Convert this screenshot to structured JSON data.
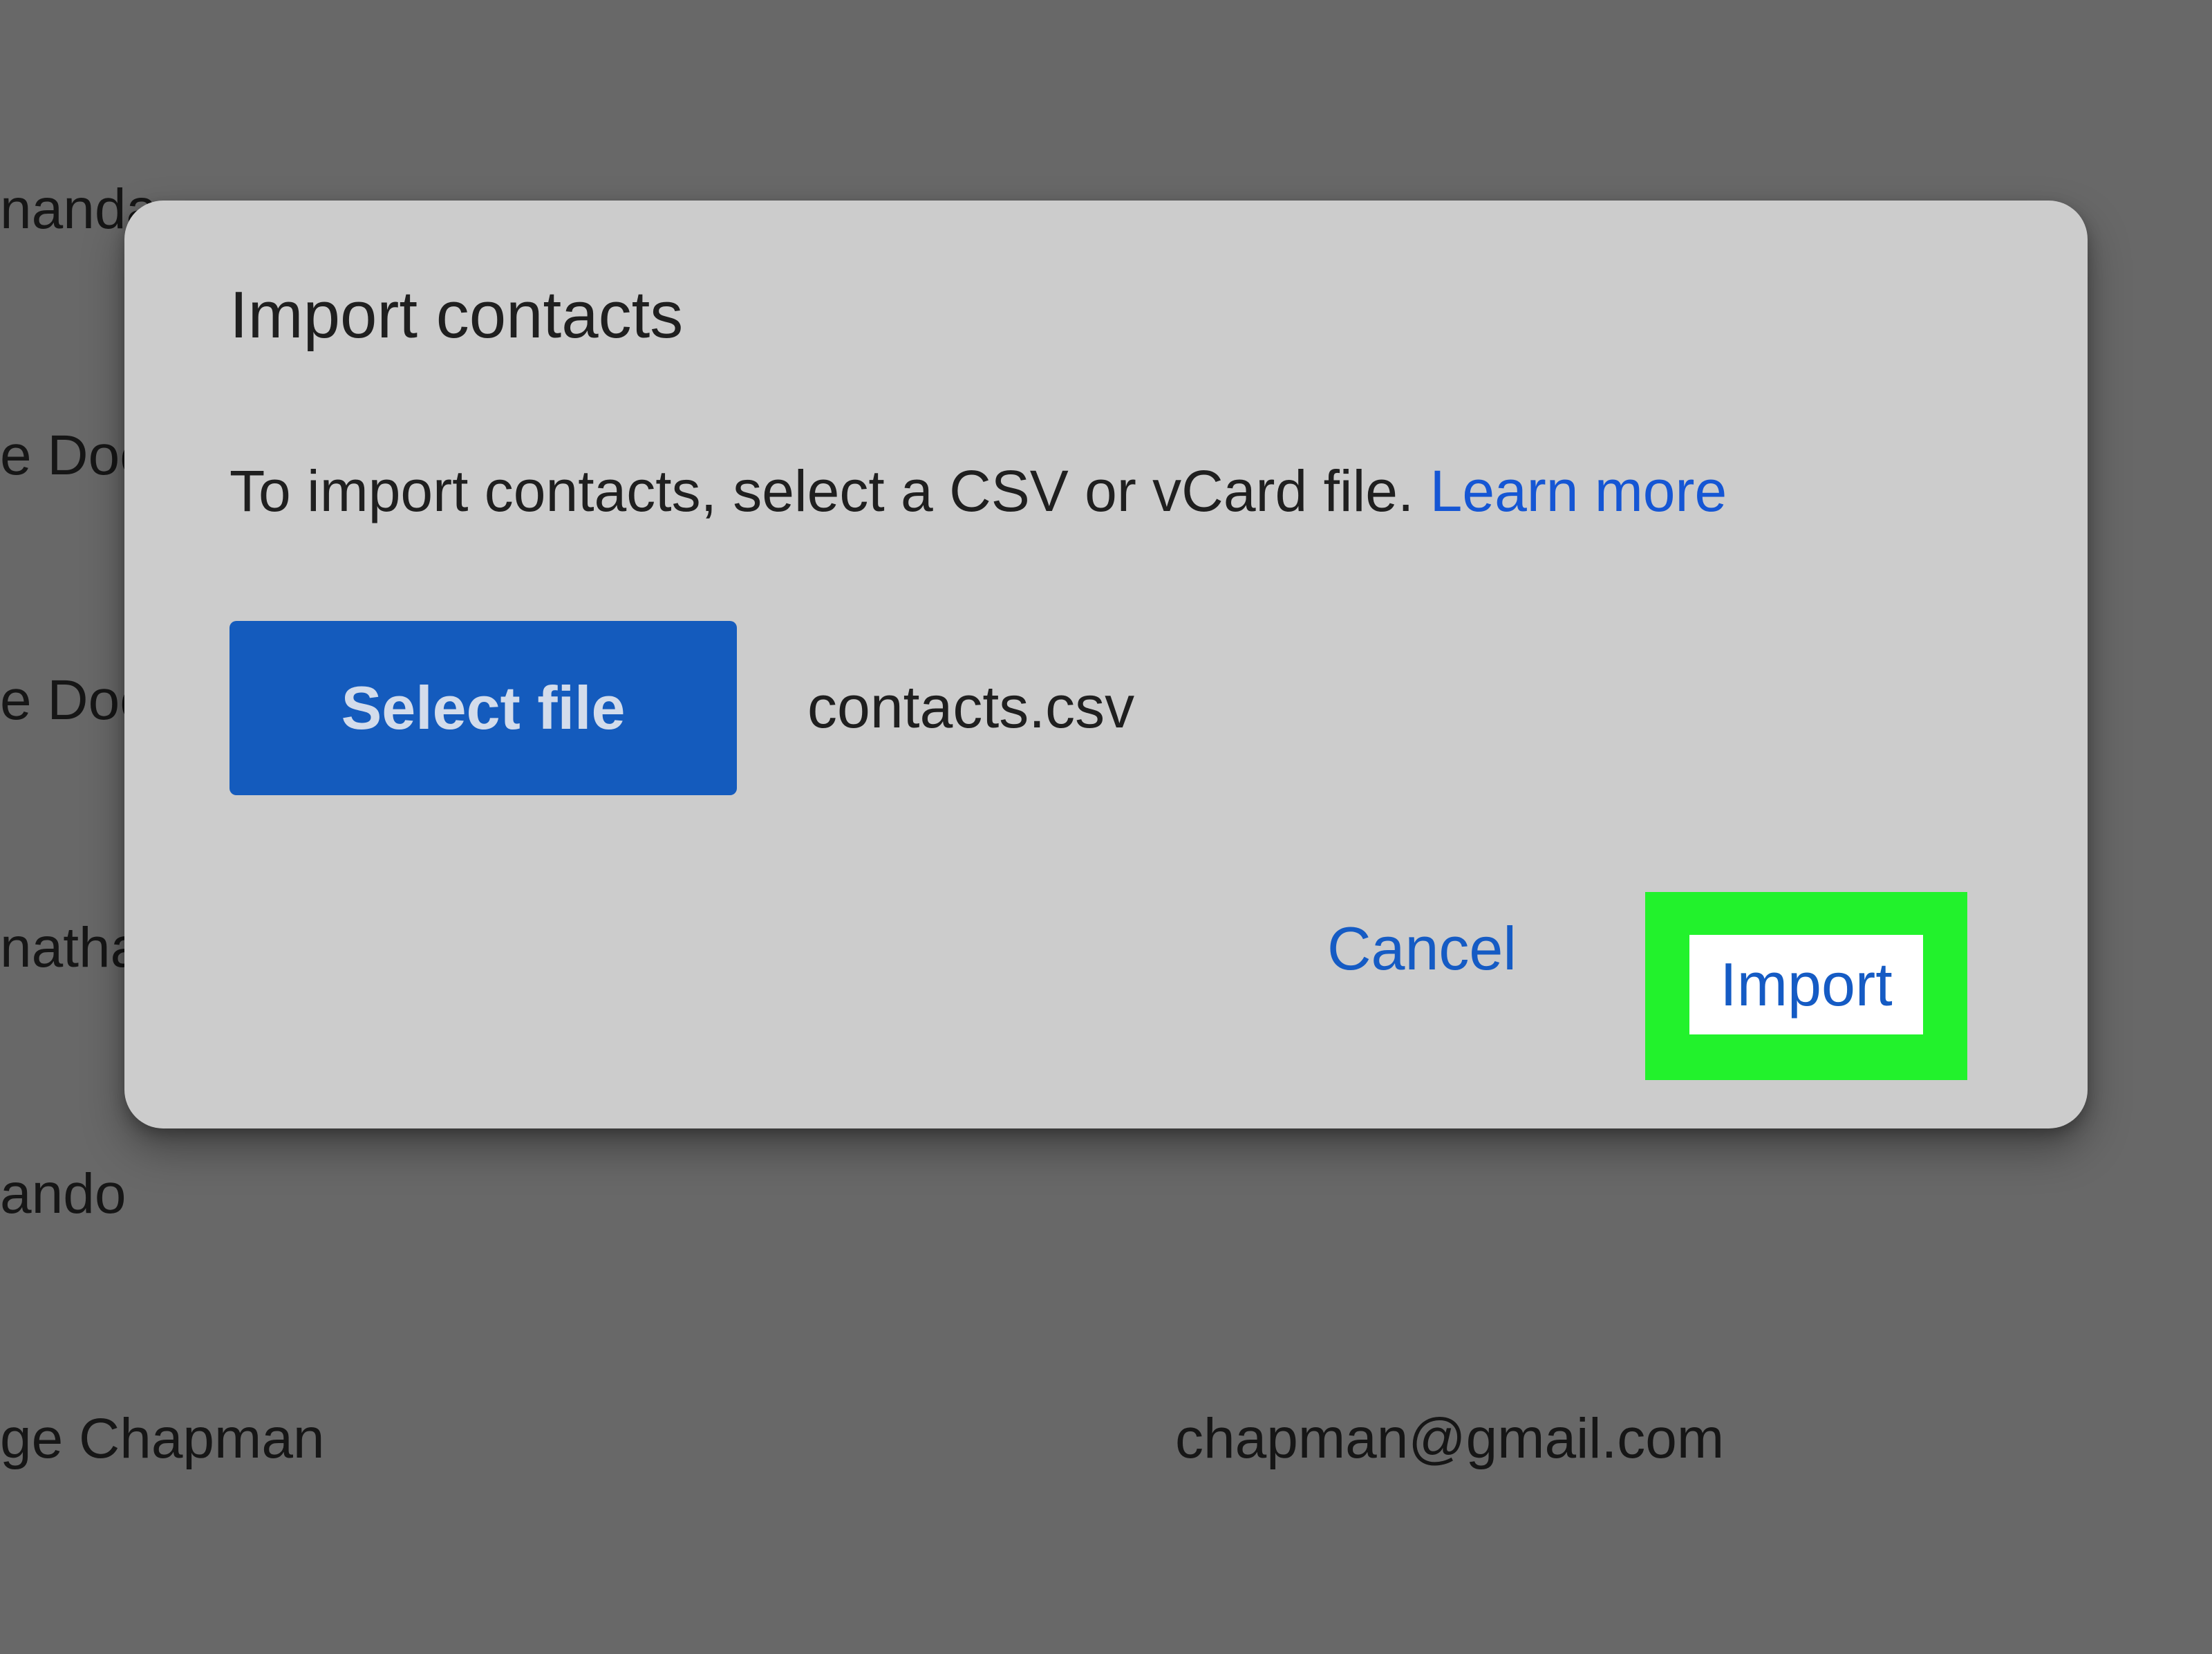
{
  "background_list": {
    "rows": [
      {
        "name": "nanda"
      },
      {
        "name": "e Doe"
      },
      {
        "name": "e Doe"
      },
      {
        "name": "natha"
      },
      {
        "name": "ando"
      },
      {
        "name": "ge Chapman",
        "email": "chapman@gmail.com"
      }
    ]
  },
  "dialog": {
    "title": "Import contacts",
    "description": "To import contacts, select a CSV or vCard file.",
    "learn_more_label": "Learn more",
    "select_file_label": "Select file",
    "selected_file_name": "contacts.csv",
    "cancel_label": "Cancel",
    "import_label": "Import"
  },
  "colors": {
    "overlay": "#686868",
    "dialog_bg": "#cccccc",
    "primary_button": "#145bbd",
    "link": "#1556d4",
    "highlight": "#22f22c"
  }
}
